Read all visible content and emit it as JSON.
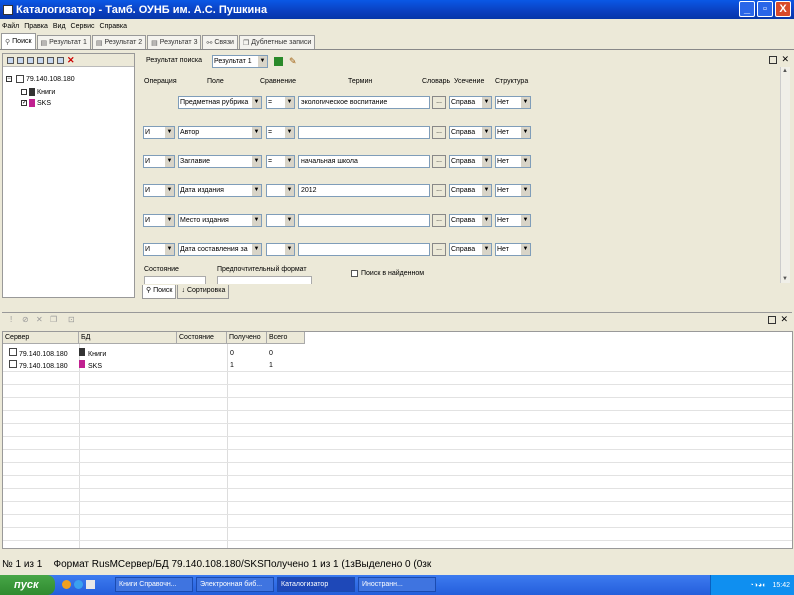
{
  "window": {
    "title": "Каталогизатор - Тамб. ОУНБ им. А.С. Пушкина"
  },
  "menu": [
    "Файл",
    "Правка",
    "Вид",
    "Сервис",
    "Справка"
  ],
  "tabs": [
    "Поиск",
    "Результат 1",
    "Результат 2",
    "Результат 3",
    "Связи",
    "Дублетные записи"
  ],
  "tree": {
    "server": "79.140.108.180",
    "dbs": [
      "Книги",
      "SKS"
    ]
  },
  "search": {
    "result_label": "Результат поиска",
    "result_value": "Результат 1",
    "headers": {
      "operation": "Операция",
      "field": "Поле",
      "compare": "Сравнение",
      "term": "Термин",
      "dict": "Словарь",
      "condition": "Усечение",
      "structure": "Структура"
    },
    "rows": [
      {
        "op": "",
        "field": "Предметная рубрика",
        "cmp": "=",
        "term": "экологическое воспитание",
        "cond": "Справа",
        "struct": "Нет"
      },
      {
        "op": "И",
        "field": "Автор",
        "cmp": "=",
        "term": "",
        "cond": "Справа",
        "struct": "Нет"
      },
      {
        "op": "И",
        "field": "Заглавие",
        "cmp": "=",
        "term": "начальная школа",
        "cond": "Справа",
        "struct": "Нет"
      },
      {
        "op": "И",
        "field": "Дата издания",
        "cmp": "",
        "term": "2012",
        "cond": "Справа",
        "struct": "Нет"
      },
      {
        "op": "И",
        "field": "Место издания",
        "cmp": "",
        "term": "",
        "cond": "Справа",
        "struct": "Нет"
      },
      {
        "op": "И",
        "field": "Дата составления за",
        "cmp": "",
        "term": "",
        "cond": "Справа",
        "struct": "Нет"
      }
    ],
    "state_label": "Состояние",
    "format_label": "Предпочтительный формат",
    "in_found_label": "Поиск в найденном",
    "bottom_tabs": [
      "Поиск",
      "Сортировка"
    ]
  },
  "grid": {
    "columns": [
      "Сервер",
      "БД",
      "Состояние",
      "Получено",
      "Всего"
    ],
    "rows": [
      {
        "server": "79.140.108.180",
        "db": "Книги",
        "state": "",
        "got": "0",
        "total": "0"
      },
      {
        "server": "79.140.108.180",
        "db": "SKS",
        "state": "",
        "got": "1",
        "total": "1"
      }
    ]
  },
  "status": {
    "record": "№ 1 из 1",
    "format": "Формат RusM",
    "server": "Сервер/БД 79.140.108.180/SKS",
    "got": "Получено 1 из 1 (1з",
    "selected": "Выделено 0 (0зк"
  },
  "taskbar": {
    "start": "пуск",
    "items": [
      "Книги Справочн...",
      "Электронная биб...",
      "Каталогизатор",
      "Иностранн..."
    ],
    "clock": "15:42"
  }
}
